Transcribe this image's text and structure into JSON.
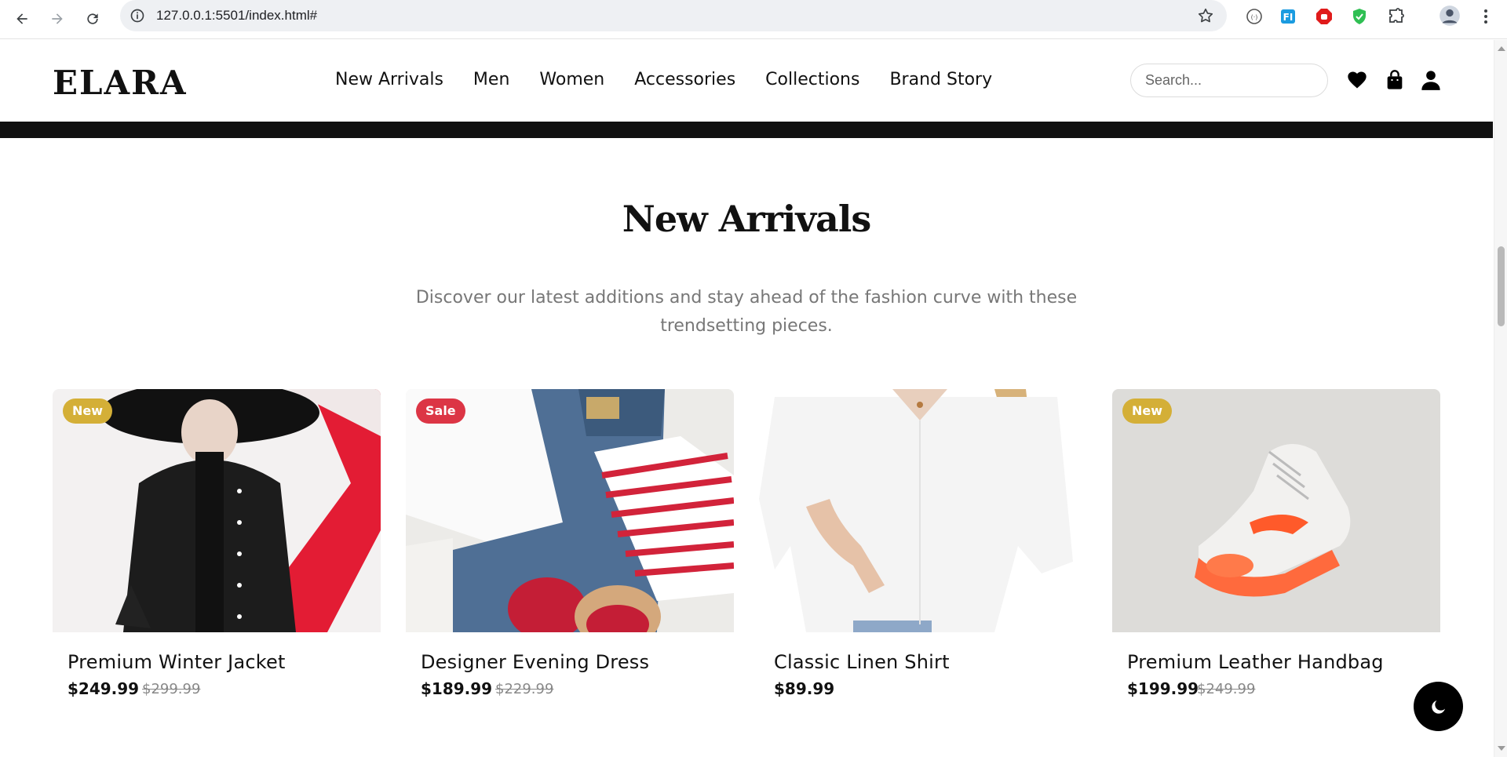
{
  "browser": {
    "url": "127.0.0.1:5501/index.html#",
    "icons": [
      "back-arrow-icon",
      "forward-arrow-icon",
      "reload-icon",
      "info-icon",
      "star-icon",
      "extension-icons",
      "puzzle-icon",
      "profile-avatar",
      "menu-dots-icon"
    ]
  },
  "header": {
    "logo": "ELARA",
    "nav": [
      "New Arrivals",
      "Men",
      "Women",
      "Accessories",
      "Collections",
      "Brand Story"
    ],
    "search_placeholder": "Search...",
    "icons": [
      "heart-icon",
      "bag-icon",
      "user-icon"
    ]
  },
  "section": {
    "title": "New Arrivals",
    "subtitle": "Discover our latest additions and stay ahead of the fashion curve with these trendsetting pieces."
  },
  "products": [
    {
      "badge": "New",
      "badge_type": "new",
      "name": "Premium Winter Jacket",
      "price": "$249.99",
      "old_price": "$299.99"
    },
    {
      "badge": "Sale",
      "badge_type": "sale",
      "name": "Designer Evening Dress",
      "price": "$189.99",
      "old_price": "$229.99"
    },
    {
      "badge": "",
      "badge_type": "",
      "name": "Classic Linen Shirt",
      "price": "$89.99",
      "old_price": ""
    },
    {
      "badge": "New",
      "badge_type": "new",
      "name": "Premium Leather Handbag",
      "price": "$199.99",
      "old_price": "$249.99"
    }
  ],
  "colors": {
    "accent_new": "#d4af37",
    "accent_sale": "#dc3545",
    "text": "#111111",
    "muted": "#777777"
  },
  "theme_toggle_icon": "moon-icon"
}
